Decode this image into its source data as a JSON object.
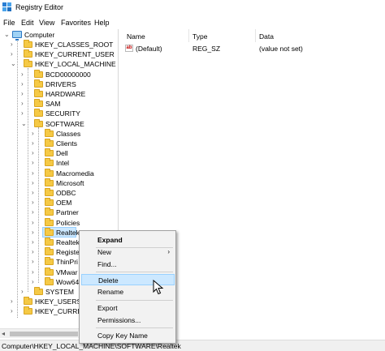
{
  "window": {
    "title": "Registry Editor"
  },
  "menubar": [
    "File",
    "Edit",
    "View",
    "Favorites",
    "Help"
  ],
  "tree": {
    "root": "Computer",
    "items": [
      {
        "label": "HKEY_CLASSES_ROOT",
        "level": 1,
        "expanded": false
      },
      {
        "label": "HKEY_CURRENT_USER",
        "level": 1,
        "expanded": false
      },
      {
        "label": "HKEY_LOCAL_MACHINE",
        "level": 1,
        "expanded": true
      },
      {
        "label": "BCD00000000",
        "level": 2,
        "expanded": false
      },
      {
        "label": "DRIVERS",
        "level": 2,
        "expanded": false
      },
      {
        "label": "HARDWARE",
        "level": 2,
        "expanded": false
      },
      {
        "label": "SAM",
        "level": 2,
        "expanded": false
      },
      {
        "label": "SECURITY",
        "level": 2,
        "expanded": false
      },
      {
        "label": "SOFTWARE",
        "level": 2,
        "expanded": true
      },
      {
        "label": "Classes",
        "level": 3,
        "expanded": false
      },
      {
        "label": "Clients",
        "level": 3,
        "expanded": false
      },
      {
        "label": "Dell",
        "level": 3,
        "expanded": false
      },
      {
        "label": "Intel",
        "level": 3,
        "expanded": false
      },
      {
        "label": "Macromedia",
        "level": 3,
        "expanded": false
      },
      {
        "label": "Microsoft",
        "level": 3,
        "expanded": false
      },
      {
        "label": "ODBC",
        "level": 3,
        "expanded": false
      },
      {
        "label": "OEM",
        "level": 3,
        "expanded": false
      },
      {
        "label": "Partner",
        "level": 3,
        "expanded": false
      },
      {
        "label": "Policies",
        "level": 3,
        "expanded": false
      },
      {
        "label": "Realtek",
        "level": 3,
        "expanded": false,
        "selected": true
      },
      {
        "label": "Realtek",
        "level": 3,
        "expanded": false
      },
      {
        "label": "Registe",
        "level": 3,
        "expanded": false
      },
      {
        "label": "ThinPri",
        "level": 3,
        "expanded": false
      },
      {
        "label": "VMwar",
        "level": 3,
        "expanded": false
      },
      {
        "label": "Wow64",
        "level": 3,
        "expanded": false
      },
      {
        "label": "SYSTEM",
        "level": 2,
        "expanded": false
      },
      {
        "label": "HKEY_USERS",
        "level": 1,
        "expanded": false
      },
      {
        "label": "HKEY_CURREN",
        "level": 1,
        "expanded": false
      }
    ]
  },
  "list": {
    "columns": [
      "Name",
      "Type",
      "Data"
    ],
    "rows": [
      {
        "icon": "ab",
        "name": "(Default)",
        "type": "REG_SZ",
        "data": "(value not set)"
      }
    ]
  },
  "context_menu": {
    "items": [
      "Expand",
      "New",
      "Find...",
      "Delete",
      "Rename",
      "Export",
      "Permissions...",
      "Copy Key Name"
    ],
    "highlighted": "Delete"
  },
  "status": {
    "path": "Computer\\HKEY_LOCAL_MACHINE\\SOFTWARE\\Realtek"
  }
}
